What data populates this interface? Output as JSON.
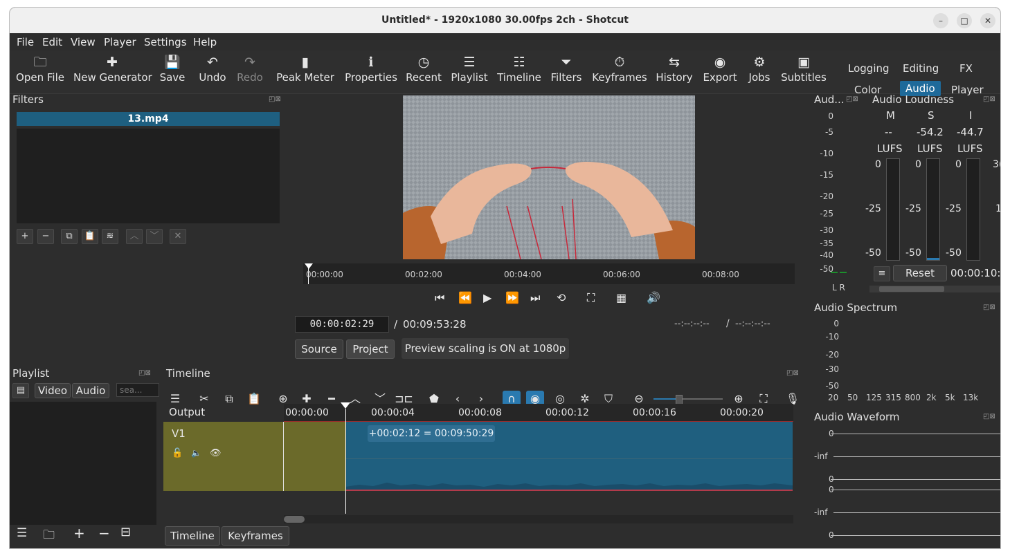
{
  "window": {
    "title": "Untitled* - 1920x1080 30.00fps 2ch - Shotcut",
    "minimize": "–",
    "maximize": "□",
    "close": "✕"
  },
  "menu": [
    "File",
    "Edit",
    "View",
    "Player",
    "Settings",
    "Help"
  ],
  "toolbar": {
    "open_file": "Open File",
    "new_generator": "New Generator",
    "save": "Save",
    "undo": "Undo",
    "redo": "Redo",
    "peak_meter": "Peak Meter",
    "properties": "Properties",
    "recent": "Recent",
    "playlist": "Playlist",
    "timeline": "Timeline",
    "filters": "Filters",
    "keyframes": "Keyframes",
    "history": "History",
    "export": "Export",
    "jobs": "Jobs",
    "subtitles": "Subtitles"
  },
  "layouts": {
    "logging": "Logging",
    "editing": "Editing",
    "fx": "FX",
    "color": "Color",
    "audio": "Audio",
    "player": "Player"
  },
  "filters": {
    "title": "Filters",
    "clip": "13.mp4"
  },
  "player": {
    "ruler": [
      "00:00:00",
      "00:02:00",
      "00:04:00",
      "00:06:00",
      "00:08:00"
    ],
    "position": "00:00:02:29",
    "separator": "/",
    "duration": "00:09:53:28",
    "in_point": "--:--:--:--",
    "out_point": "--:--:--:--",
    "source_tab": "Source",
    "project_tab": "Project",
    "scaling_note": "Preview scaling is ON at 1080p"
  },
  "audio_meter": {
    "title": "Aud...",
    "scale": [
      "0",
      "-5",
      "-10",
      "-15",
      "-20",
      "-25",
      "-30",
      "-35",
      "-40",
      "-50"
    ],
    "lr": "L R"
  },
  "loudness": {
    "title": "Audio Loudness",
    "cols": [
      {
        "head": "M",
        "value": "--",
        "unit": "LUFS",
        "top": "0",
        "mid": "-25",
        "bot": "-50"
      },
      {
        "head": "S",
        "value": "-54.2",
        "unit": "LUFS",
        "top": "0",
        "mid": "-25",
        "bot": "-50"
      },
      {
        "head": "I",
        "value": "-44.7",
        "unit": "LUFS",
        "top": "0",
        "mid": "-25",
        "bot": "-50"
      }
    ],
    "extra_top": "3(",
    "extra_mid": "1",
    "reset": "Reset",
    "time": "00:00:10:0"
  },
  "spectrum": {
    "title": "Audio Spectrum",
    "scale": [
      "0",
      "-10",
      "-20",
      "-30",
      "-50"
    ],
    "freqs": [
      "20",
      "50",
      "125",
      "315",
      "800",
      "2k",
      "5k",
      "13k"
    ]
  },
  "waveform": {
    "title": "Audio Waveform",
    "labels": [
      "0",
      "-inf",
      "0",
      "0",
      "-inf",
      "0"
    ]
  },
  "playlist": {
    "title": "Playlist",
    "video": "Video",
    "audio": "Audio",
    "search_placeholder": "sea..."
  },
  "timeline": {
    "title": "Timeline",
    "output": "Output",
    "track": "V1",
    "ruler": [
      "00:00:00",
      "00:00:04",
      "00:00:08",
      "00:00:12",
      "00:00:16",
      "00:00:20"
    ],
    "tooltip": "+00:02:12 = 00:09:50:29",
    "tab_timeline": "Timeline",
    "tab_keyframes": "Keyframes"
  },
  "colors": {
    "accent": "#2a7ab0",
    "clip": "#1f5f7f",
    "track_selected": "#6b6a2a"
  }
}
